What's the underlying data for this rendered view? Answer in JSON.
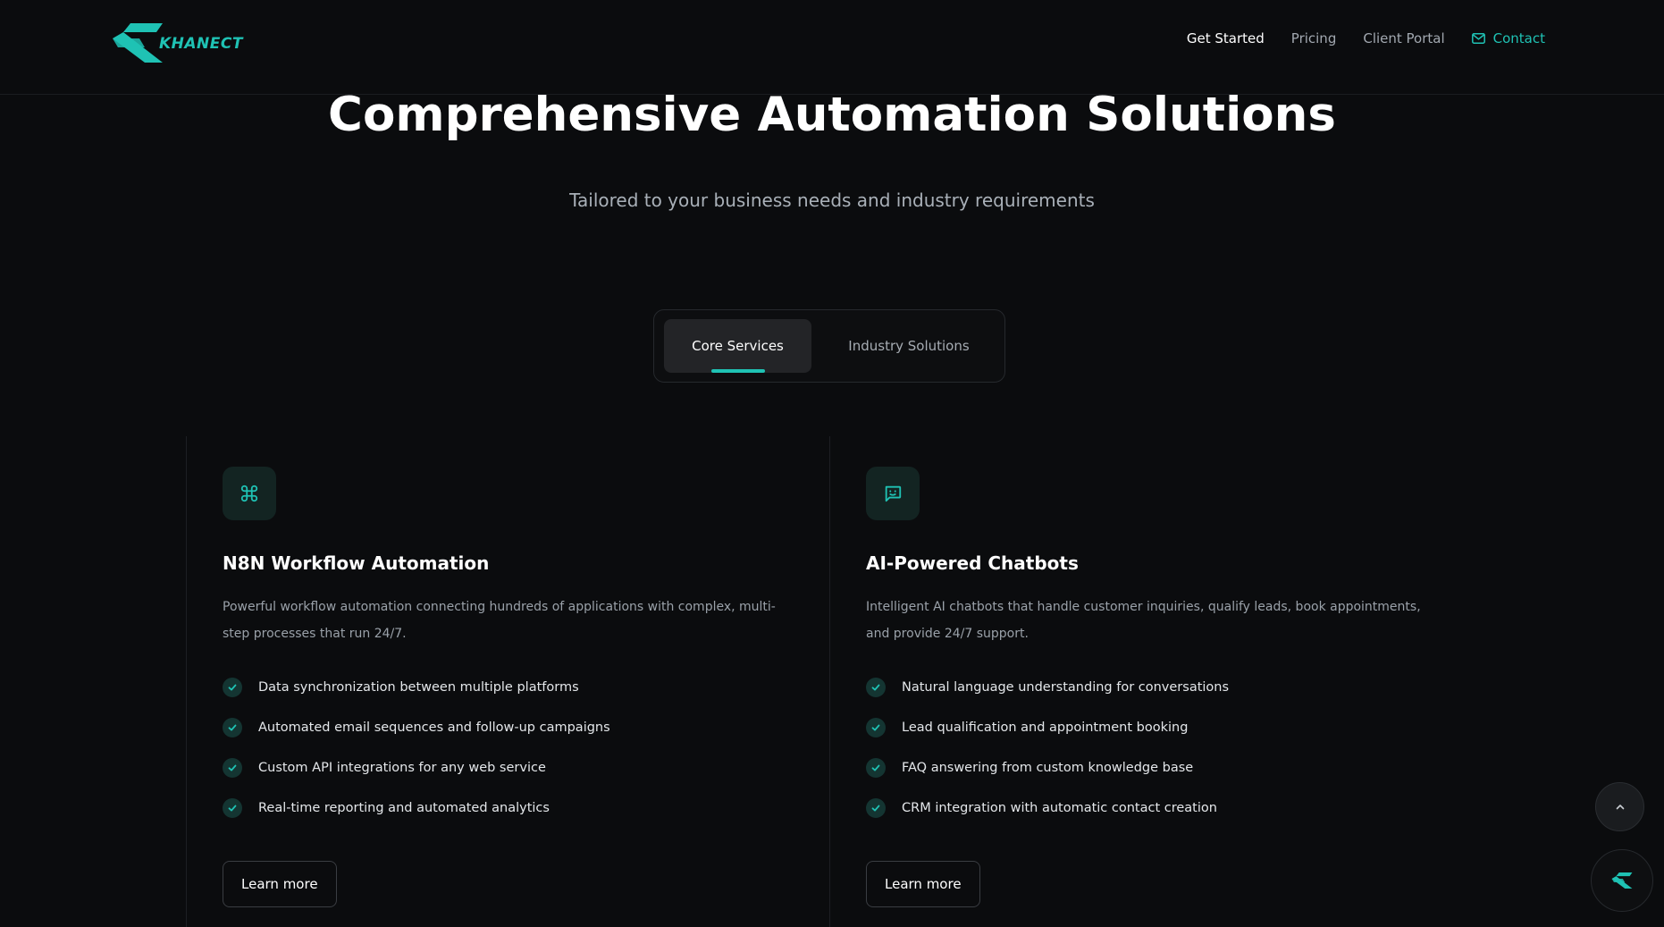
{
  "brand": {
    "name": "KHANECT",
    "accent": "#1fc2b4"
  },
  "nav": {
    "links": [
      {
        "label": "Get Started"
      },
      {
        "label": "Pricing"
      },
      {
        "label": "Client Portal"
      },
      {
        "label": "Contact",
        "icon": "mail-icon"
      }
    ]
  },
  "hero": {
    "title": "Comprehensive Automation Solutions",
    "subtitle": "Tailored to your business needs and industry requirements"
  },
  "tabs": [
    {
      "label": "Core Services",
      "active": true
    },
    {
      "label": "Industry Solutions",
      "active": false
    }
  ],
  "cards": [
    {
      "icon": "command-icon",
      "title": "N8N Workflow Automation",
      "description": "Powerful workflow automation connecting hundreds of applications with complex, multi-step processes that run 24/7.",
      "features": [
        "Data synchronization between multiple platforms",
        "Automated email sequences and follow-up campaigns",
        "Custom API integrations for any web service",
        "Real-time reporting and automated analytics"
      ],
      "cta": "Learn more"
    },
    {
      "icon": "chatbot-icon",
      "title": "AI-Powered Chatbots",
      "description": "Intelligent AI chatbots that handle customer inquiries, qualify leads, book appointments, and provide 24/7 support.",
      "features": [
        "Natural language understanding for conversations",
        "Lead qualification and appointment booking",
        "FAQ answering from custom knowledge base",
        "CRM integration with automatic contact creation"
      ],
      "cta": "Learn more"
    }
  ]
}
